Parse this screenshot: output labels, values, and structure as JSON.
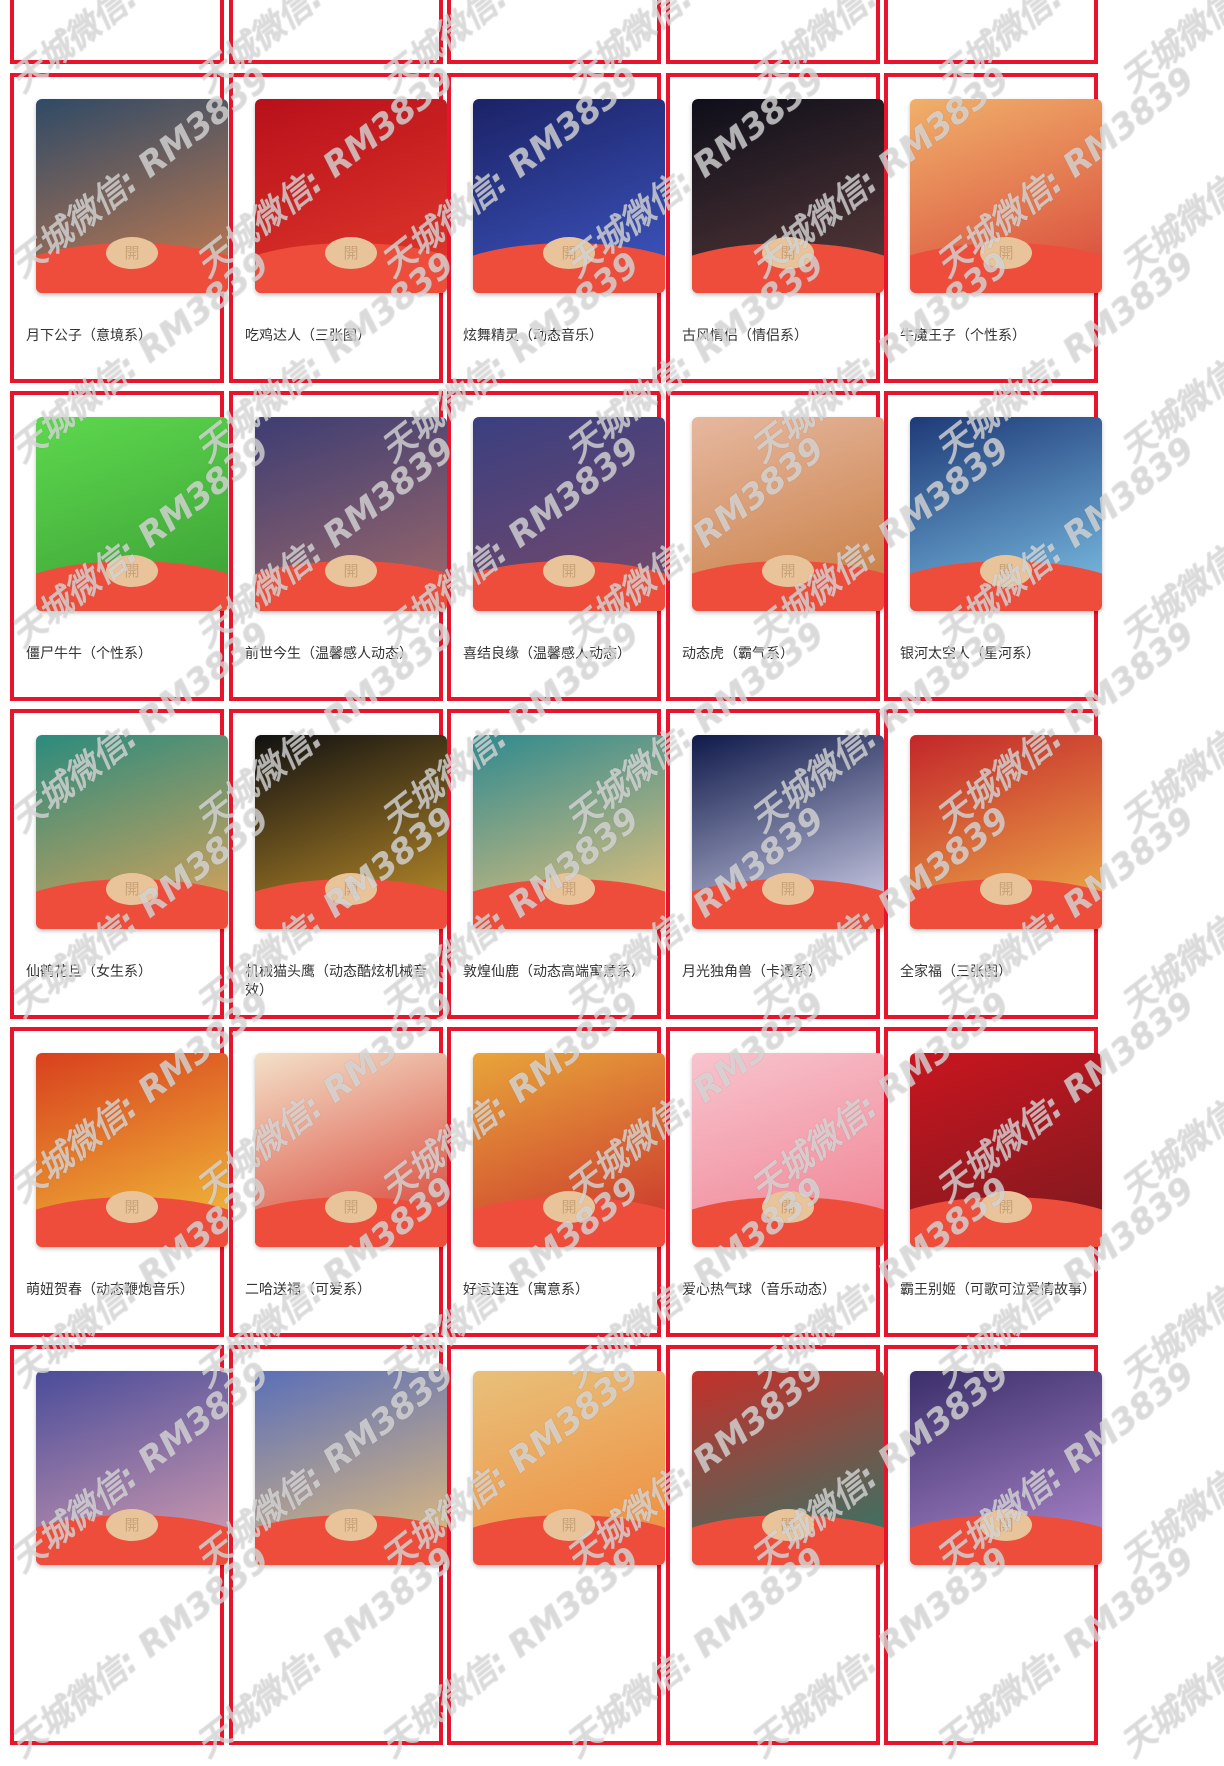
{
  "seal_text": "開",
  "watermark_text": "天城微信: RM3839",
  "colors": {
    "border": "#e8142b",
    "envelope_bottom": "#ef4d3b",
    "seal": "#e9c49a"
  },
  "cards": [
    {
      "title": "月下公子（意境系）",
      "art": [
        "#2f4a66",
        "#c97d4f"
      ]
    },
    {
      "title": "吃鸡达人（三张图）",
      "art": [
        "#b8101a",
        "#e23a2c"
      ]
    },
    {
      "title": "炫舞精灵（动态音乐）",
      "art": [
        "#1b2266",
        "#3f58c4"
      ]
    },
    {
      "title": "古风情侣（情侣系）",
      "art": [
        "#0e0e1a",
        "#5a3b3a"
      ]
    },
    {
      "title": "牛魔王子（个性系）",
      "art": [
        "#f0b06a",
        "#d8473a"
      ]
    },
    {
      "title": "僵尸牛牛（个性系）",
      "art": [
        "#5dd84e",
        "#3b9e34"
      ]
    },
    {
      "title": "前世今生（温馨感人动态）",
      "art": [
        "#3d3d73",
        "#a06a6a"
      ]
    },
    {
      "title": "喜结良缘（温馨感人动态）",
      "art": [
        "#3a3f80",
        "#7a4a6a"
      ]
    },
    {
      "title": "动态虎（霸气系）",
      "art": [
        "#e6b8a0",
        "#c77a3d"
      ]
    },
    {
      "title": "银河太空人（星河系）",
      "art": [
        "#1e3a78",
        "#7fc4e8"
      ]
    },
    {
      "title": "仙鹤花旦（女生系）",
      "art": [
        "#2b8b7d",
        "#e0a457"
      ]
    },
    {
      "title": "机械猫头鹰（动态酷炫机械音效）",
      "art": [
        "#111111",
        "#c5932a"
      ]
    },
    {
      "title": "敦煌仙鹿（动态高端寓意系）",
      "art": [
        "#2f8a8f",
        "#f0c47a"
      ]
    },
    {
      "title": "月光独角兽（卡通系）",
      "art": [
        "#0f1a4a",
        "#d8d8f0"
      ]
    },
    {
      "title": "全家福（三张图）",
      "art": [
        "#c3262a",
        "#f0b34a"
      ]
    },
    {
      "title": "萌妞贺春（动态鞭炮音乐）",
      "art": [
        "#d8401e",
        "#f2c23a"
      ]
    },
    {
      "title": "二哈送福（可爱系）",
      "art": [
        "#f3e0c8",
        "#d83a2e"
      ]
    },
    {
      "title": "好运连连（寓意系）",
      "art": [
        "#e8a53a",
        "#c9302c"
      ]
    },
    {
      "title": "爱心热气球（音乐动态）",
      "art": [
        "#f7c4ce",
        "#f08090"
      ]
    },
    {
      "title": "霸王别姬（可歌可泣爱情故事）",
      "art": [
        "#c9151f",
        "#7a1a1f"
      ]
    },
    {
      "title": "",
      "art": [
        "#4a4c9a",
        "#d8a0b0"
      ]
    },
    {
      "title": "",
      "art": [
        "#5a6fb8",
        "#e8c07a"
      ]
    },
    {
      "title": "",
      "art": [
        "#e8c07a",
        "#f08a3a"
      ]
    },
    {
      "title": "",
      "art": [
        "#c4302a",
        "#2a7a6a"
      ]
    },
    {
      "title": "",
      "art": [
        "#3b2f6a",
        "#b08ad0"
      ]
    }
  ]
}
